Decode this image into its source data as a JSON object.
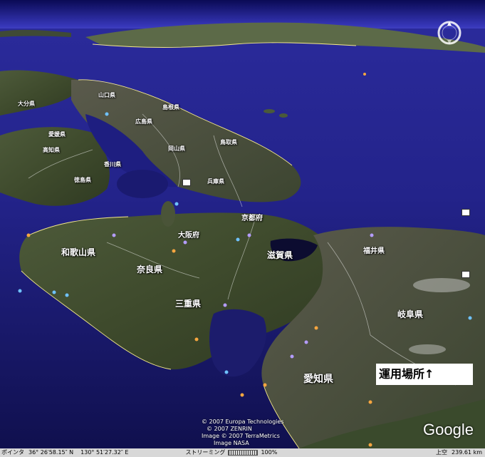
{
  "map": {
    "prefectures": [
      {
        "label": "山口県",
        "size": "small"
      },
      {
        "label": "島根県",
        "size": "small"
      },
      {
        "label": "広島県",
        "size": "small"
      },
      {
        "label": "鳥取県",
        "size": "small"
      },
      {
        "label": "岡山県",
        "size": "small"
      },
      {
        "label": "大分県",
        "size": "small"
      },
      {
        "label": "愛媛県",
        "size": "small"
      },
      {
        "label": "高知県",
        "size": "small"
      },
      {
        "label": "香川県",
        "size": "small"
      },
      {
        "label": "徳島県",
        "size": "small"
      },
      {
        "label": "兵庫県",
        "size": "small"
      },
      {
        "label": "京都府",
        "size": "mid"
      },
      {
        "label": "大阪府",
        "size": "mid"
      },
      {
        "label": "和歌山県",
        "size": "big"
      },
      {
        "label": "奈良県",
        "size": "big"
      },
      {
        "label": "滋賀県",
        "size": "big"
      },
      {
        "label": "三重県",
        "size": "big"
      },
      {
        "label": "福井県",
        "size": "mid"
      },
      {
        "label": "岐阜県",
        "size": "big"
      },
      {
        "label": "愛知県",
        "size": "big"
      }
    ],
    "callout": "運用場所↑",
    "attribution": [
      "© 2007 Europa Technologies",
      "© 2007 ZENRIN",
      "Image © 2007 TerraMetrics",
      "Image NASA"
    ],
    "logo": "Google"
  },
  "status_bar": {
    "pointer_label": "ポインタ",
    "latitude": "36°  26′58.15″ N",
    "longitude": "130°  51′27.32″ E",
    "streaming_label": "ストリーミング",
    "streaming_percent": "100%",
    "altitude_label": "上空",
    "altitude": "239.61 km"
  }
}
